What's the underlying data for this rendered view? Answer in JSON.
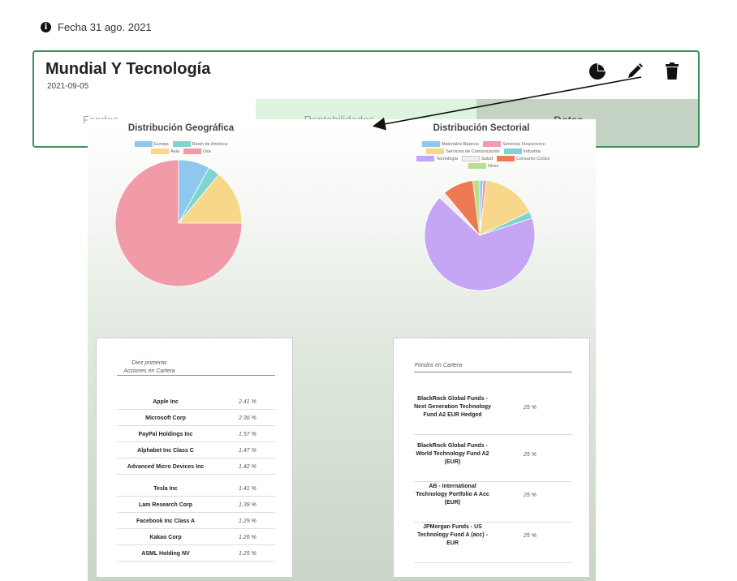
{
  "header": {
    "date_label": "Fecha 31 ago. 2021"
  },
  "card": {
    "title": "Mundial Y Tecnología",
    "subtitle": "2021-09-05",
    "actions": [
      "pie-chart-icon",
      "pencil-icon",
      "trash-icon"
    ],
    "tabs": [
      {
        "label": "Fondos"
      },
      {
        "label": "Rentabilidades"
      },
      {
        "label": "Datos"
      }
    ]
  },
  "charts": {
    "geo": {
      "title": "Distribución Geográfica",
      "legend": [
        {
          "label": "Europa",
          "color": "#8ec8ee"
        },
        {
          "label": "Resto de América",
          "color": "#7fd3d0"
        },
        {
          "label": "Asia",
          "color": "#f7d88a"
        },
        {
          "label": "Usa",
          "color": "#f19aa8"
        }
      ]
    },
    "sector": {
      "title": "Distribución Sectorial",
      "legend": [
        {
          "label": "Materiales Básicos",
          "color": "#8ec8ee"
        },
        {
          "label": "Servicios Financieros",
          "color": "#f19aa8"
        },
        {
          "label": "Servicios de Comunicación",
          "color": "#f7d88a"
        },
        {
          "label": "Industria",
          "color": "#7fd3d0"
        },
        {
          "label": "Tecnología",
          "color": "#c4a6f5"
        },
        {
          "label": "Salud",
          "color": "#eeeeee"
        },
        {
          "label": "Consumo Cíclico",
          "color": "#ee7a55"
        },
        {
          "label": "Otros",
          "color": "#b8e08a"
        }
      ]
    }
  },
  "chart_data": [
    {
      "type": "pie",
      "title": "Distribución Geográfica",
      "categories": [
        "Europa",
        "Resto de América",
        "Asia",
        "Usa"
      ],
      "values": [
        8,
        3,
        14,
        75
      ]
    },
    {
      "type": "pie",
      "title": "Distribución Sectorial",
      "categories": [
        "Materiales Básicos",
        "Servicios Financieros",
        "Servicios de Comunicación",
        "Industria",
        "Tecnología",
        "Salud",
        "Consumo Cíclico",
        "Otros"
      ],
      "values": [
        1,
        1,
        16,
        2,
        67,
        2,
        9,
        2
      ]
    }
  ],
  "holdings": {
    "heading": "Diez primeras Acciones en Cartera",
    "rows": [
      {
        "name": "Apple Inc",
        "pct": "2.41 %"
      },
      {
        "name": "Microsoft Corp",
        "pct": "2.36 %"
      },
      {
        "name": "PayPal Holdings Inc",
        "pct": "1.57 %"
      },
      {
        "name": "Alphabet Inc Class C",
        "pct": "1.47 %"
      },
      {
        "name": "Advanced Micro Devices Inc",
        "pct": "1.42 %"
      },
      {
        "name": "Tesla Inc",
        "pct": "1.41 %"
      },
      {
        "name": "Lam Research Corp",
        "pct": "1.39 %"
      },
      {
        "name": "Facebook Inc Class A",
        "pct": "1.29 %"
      },
      {
        "name": "Kakao Corp",
        "pct": "1.26 %"
      },
      {
        "name": "ASML Holding NV",
        "pct": "1.25 %"
      }
    ]
  },
  "funds": {
    "heading": "Fondos en Cartera",
    "rows": [
      {
        "name": "BlackRock Global Funds - Next Generation Technology Fund A2 EUR Hedged",
        "pct": "25 %"
      },
      {
        "name": "BlackRock Global Funds - World Technology Fund A2 (EUR)",
        "pct": "25 %"
      },
      {
        "name": "AB - International Technology Portfolio A Acc (EUR)",
        "pct": "25 %"
      },
      {
        "name": "JPMorgan Funds - US Technology Fund A (acc) - EUR",
        "pct": "25 %"
      }
    ]
  }
}
